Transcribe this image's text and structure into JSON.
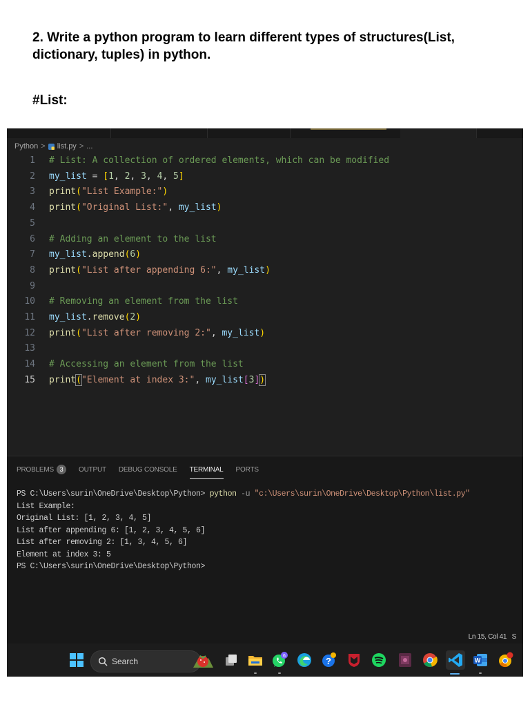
{
  "document": {
    "heading": "2. Write a python program to learn different types of structures(List, dictionary, tuples) in python.",
    "subheading": "#List:"
  },
  "breadcrumb": {
    "folder": "Python",
    "separator": ">",
    "file": "list.py",
    "ellipsis": "..."
  },
  "editor": {
    "lines": [
      {
        "num": "1",
        "parts": [
          {
            "t": "# List: A collection of ordered elements, which can be modified",
            "c": "cmt"
          }
        ]
      },
      {
        "num": "2",
        "parts": [
          {
            "t": "my_list",
            "c": "var"
          },
          {
            "t": " = ",
            "c": "op"
          },
          {
            "t": "[",
            "c": "br"
          },
          {
            "t": "1",
            "c": "num"
          },
          {
            "t": ", ",
            "c": "op"
          },
          {
            "t": "2",
            "c": "num"
          },
          {
            "t": ", ",
            "c": "op"
          },
          {
            "t": "3",
            "c": "num"
          },
          {
            "t": ", ",
            "c": "op"
          },
          {
            "t": "4",
            "c": "num"
          },
          {
            "t": ", ",
            "c": "op"
          },
          {
            "t": "5",
            "c": "num"
          },
          {
            "t": "]",
            "c": "br"
          }
        ]
      },
      {
        "num": "3",
        "parts": [
          {
            "t": "print",
            "c": "fn"
          },
          {
            "t": "(",
            "c": "br"
          },
          {
            "t": "\"List Example:\"",
            "c": "str"
          },
          {
            "t": ")",
            "c": "br"
          }
        ]
      },
      {
        "num": "4",
        "parts": [
          {
            "t": "print",
            "c": "fn"
          },
          {
            "t": "(",
            "c": "br"
          },
          {
            "t": "\"Original List:\"",
            "c": "str"
          },
          {
            "t": ", ",
            "c": "op"
          },
          {
            "t": "my_list",
            "c": "var"
          },
          {
            "t": ")",
            "c": "br"
          }
        ]
      },
      {
        "num": "5",
        "parts": []
      },
      {
        "num": "6",
        "parts": [
          {
            "t": "# Adding an element to the list",
            "c": "cmt"
          }
        ]
      },
      {
        "num": "7",
        "parts": [
          {
            "t": "my_list",
            "c": "var"
          },
          {
            "t": ".",
            "c": "op"
          },
          {
            "t": "append",
            "c": "fn"
          },
          {
            "t": "(",
            "c": "br"
          },
          {
            "t": "6",
            "c": "num"
          },
          {
            "t": ")",
            "c": "br"
          }
        ]
      },
      {
        "num": "8",
        "parts": [
          {
            "t": "print",
            "c": "fn"
          },
          {
            "t": "(",
            "c": "br"
          },
          {
            "t": "\"List after appending 6:\"",
            "c": "str"
          },
          {
            "t": ", ",
            "c": "op"
          },
          {
            "t": "my_list",
            "c": "var"
          },
          {
            "t": ")",
            "c": "br"
          }
        ]
      },
      {
        "num": "9",
        "parts": []
      },
      {
        "num": "10",
        "parts": [
          {
            "t": "# Removing an element from the list",
            "c": "cmt"
          }
        ]
      },
      {
        "num": "11",
        "parts": [
          {
            "t": "my_list",
            "c": "var"
          },
          {
            "t": ".",
            "c": "op"
          },
          {
            "t": "remove",
            "c": "fn"
          },
          {
            "t": "(",
            "c": "br"
          },
          {
            "t": "2",
            "c": "num"
          },
          {
            "t": ")",
            "c": "br"
          }
        ]
      },
      {
        "num": "12",
        "parts": [
          {
            "t": "print",
            "c": "fn"
          },
          {
            "t": "(",
            "c": "br"
          },
          {
            "t": "\"List after removing 2:\"",
            "c": "str"
          },
          {
            "t": ", ",
            "c": "op"
          },
          {
            "t": "my_list",
            "c": "var"
          },
          {
            "t": ")",
            "c": "br"
          }
        ]
      },
      {
        "num": "13",
        "parts": []
      },
      {
        "num": "14",
        "parts": [
          {
            "t": "# Accessing an element from the list",
            "c": "cmt"
          }
        ]
      },
      {
        "num": "15",
        "current": true,
        "parts": [
          {
            "t": "print",
            "c": "fn"
          },
          {
            "t": "(",
            "c": "br box"
          },
          {
            "t": "\"Element at index 3:\"",
            "c": "str"
          },
          {
            "t": ", ",
            "c": "op"
          },
          {
            "t": "my_list",
            "c": "var"
          },
          {
            "t": "[",
            "c": "br2"
          },
          {
            "t": "3",
            "c": "num"
          },
          {
            "t": "]",
            "c": "br2"
          },
          {
            "t": ")",
            "c": "br box"
          }
        ]
      }
    ]
  },
  "panel": {
    "tabs": [
      {
        "label": "PROBLEMS",
        "badge": "3",
        "active": false
      },
      {
        "label": "OUTPUT",
        "active": false
      },
      {
        "label": "DEBUG CONSOLE",
        "active": false
      },
      {
        "label": "TERMINAL",
        "active": true
      },
      {
        "label": "PORTS",
        "active": false
      }
    ],
    "terminal": {
      "prompt": "PS C:\\Users\\surin\\OneDrive\\Desktop\\Python>",
      "command": "python",
      "flag": "-u",
      "arg": "\"c:\\Users\\surin\\OneDrive\\Desktop\\Python\\list.py\"",
      "output": [
        "List Example:",
        "Original List: [1, 2, 3, 4, 5]",
        "List after appending 6: [1, 2, 3, 4, 5, 6]",
        "List after removing 2: [1, 3, 4, 5, 6]",
        "Element at index 3: 5"
      ],
      "final_prompt": "PS C:\\Users\\surin\\OneDrive\\Desktop\\Python>"
    }
  },
  "statusbar": {
    "position": "Ln 15, Col 41",
    "cut_text": "S"
  },
  "taskbar": {
    "search_label": "Search",
    "whatsapp_badge": "6",
    "items": [
      "windows-start-icon",
      "search-box",
      "strawberry-widget-icon",
      "task-view-icon",
      "file-explorer-icon",
      "whatsapp-icon",
      "edge-icon",
      "help-icon",
      "mcafee-icon",
      "spotify-icon",
      "media-app-icon",
      "chrome-icon",
      "vscode-icon",
      "word-icon",
      "chrome-canary-icon"
    ]
  },
  "colors": {
    "editor_bg": "#1f1f1f",
    "comment": "#6a9955",
    "variable": "#9cdcfe",
    "function": "#dcdcaa",
    "string": "#ce9178",
    "number": "#b5cea8",
    "bracket": "#ffd700"
  }
}
